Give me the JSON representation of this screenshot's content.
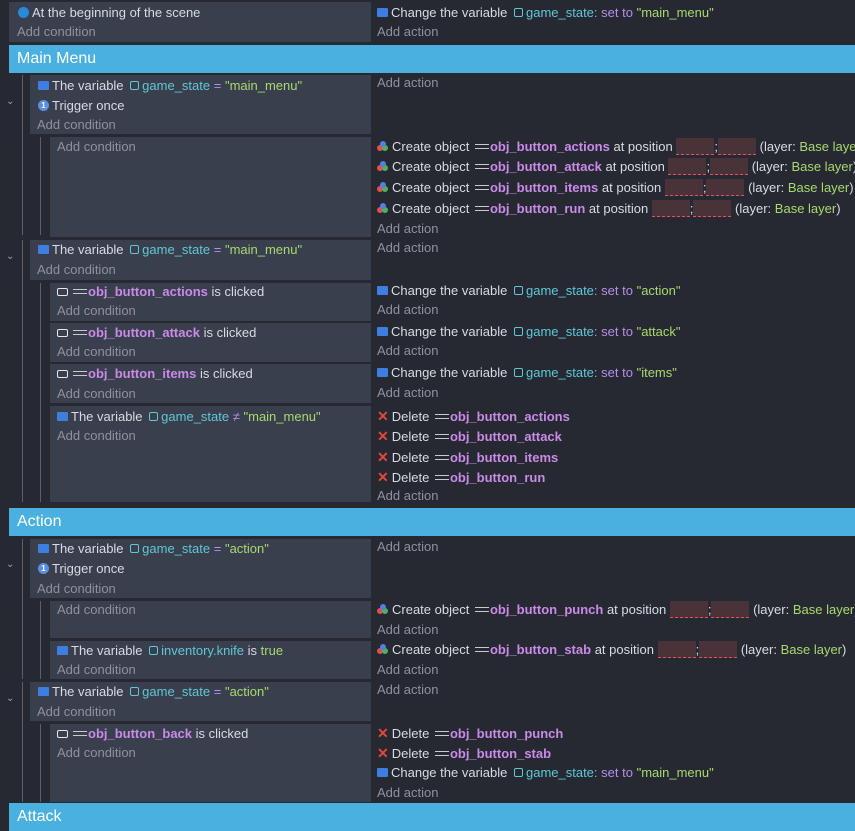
{
  "top_event": {
    "condition": "At the beginning of the scene",
    "add_condition": "Add condition",
    "action": {
      "prefix": "Change the variable",
      "var": "game_state",
      "op": ": set to",
      "value": "\"main_menu\""
    },
    "add_action": "Add action"
  },
  "groups": [
    {
      "title": "Main Menu"
    },
    {
      "title": "Action"
    },
    {
      "title": "Attack"
    }
  ],
  "common": {
    "add_condition": "Add condition",
    "add_action": "Add action",
    "the_variable": "The variable",
    "change_variable": "Change the variable",
    "set_to": ": set to",
    "trigger_once": "Trigger once",
    "create_object": "Create object",
    "at_position": "at position",
    "layer_open": "(layer:",
    "layer_close": ")",
    "base_layer": "Base layer",
    "is_clicked": "is clicked",
    "delete": "Delete",
    "eq": "=",
    "neq": "≠",
    "is_true": "is",
    "true": "true",
    "semicolon": ";"
  },
  "main_menu": {
    "ev1_var": "game_state",
    "ev1_val": "\"main_menu\"",
    "creates": [
      "obj_button_actions",
      "obj_button_attack",
      "obj_button_items",
      "obj_button_run"
    ],
    "ev2_var": "game_state",
    "ev2_val": "\"main_menu\"",
    "clicks": [
      {
        "object": "obj_button_actions",
        "value": "\"action\""
      },
      {
        "object": "obj_button_attack",
        "value": "\"attack\""
      },
      {
        "object": "obj_button_items",
        "value": "\"items\""
      }
    ],
    "neq_var": "game_state",
    "neq_val": "\"main_menu\"",
    "deletes": [
      "obj_button_actions",
      "obj_button_attack",
      "obj_button_items",
      "obj_button_run"
    ]
  },
  "action": {
    "ev1_var": "game_state",
    "ev1_val": "\"action\"",
    "create_punch": "obj_button_punch",
    "knife_var": "inventory.knife",
    "create_stab": "obj_button_stab",
    "ev2_var": "game_state",
    "ev2_val": "\"action\"",
    "back_obj": "obj_button_back",
    "deletes": [
      "obj_button_punch",
      "obj_button_stab"
    ],
    "final_var": "game_state",
    "final_val": "\"main_menu\""
  }
}
